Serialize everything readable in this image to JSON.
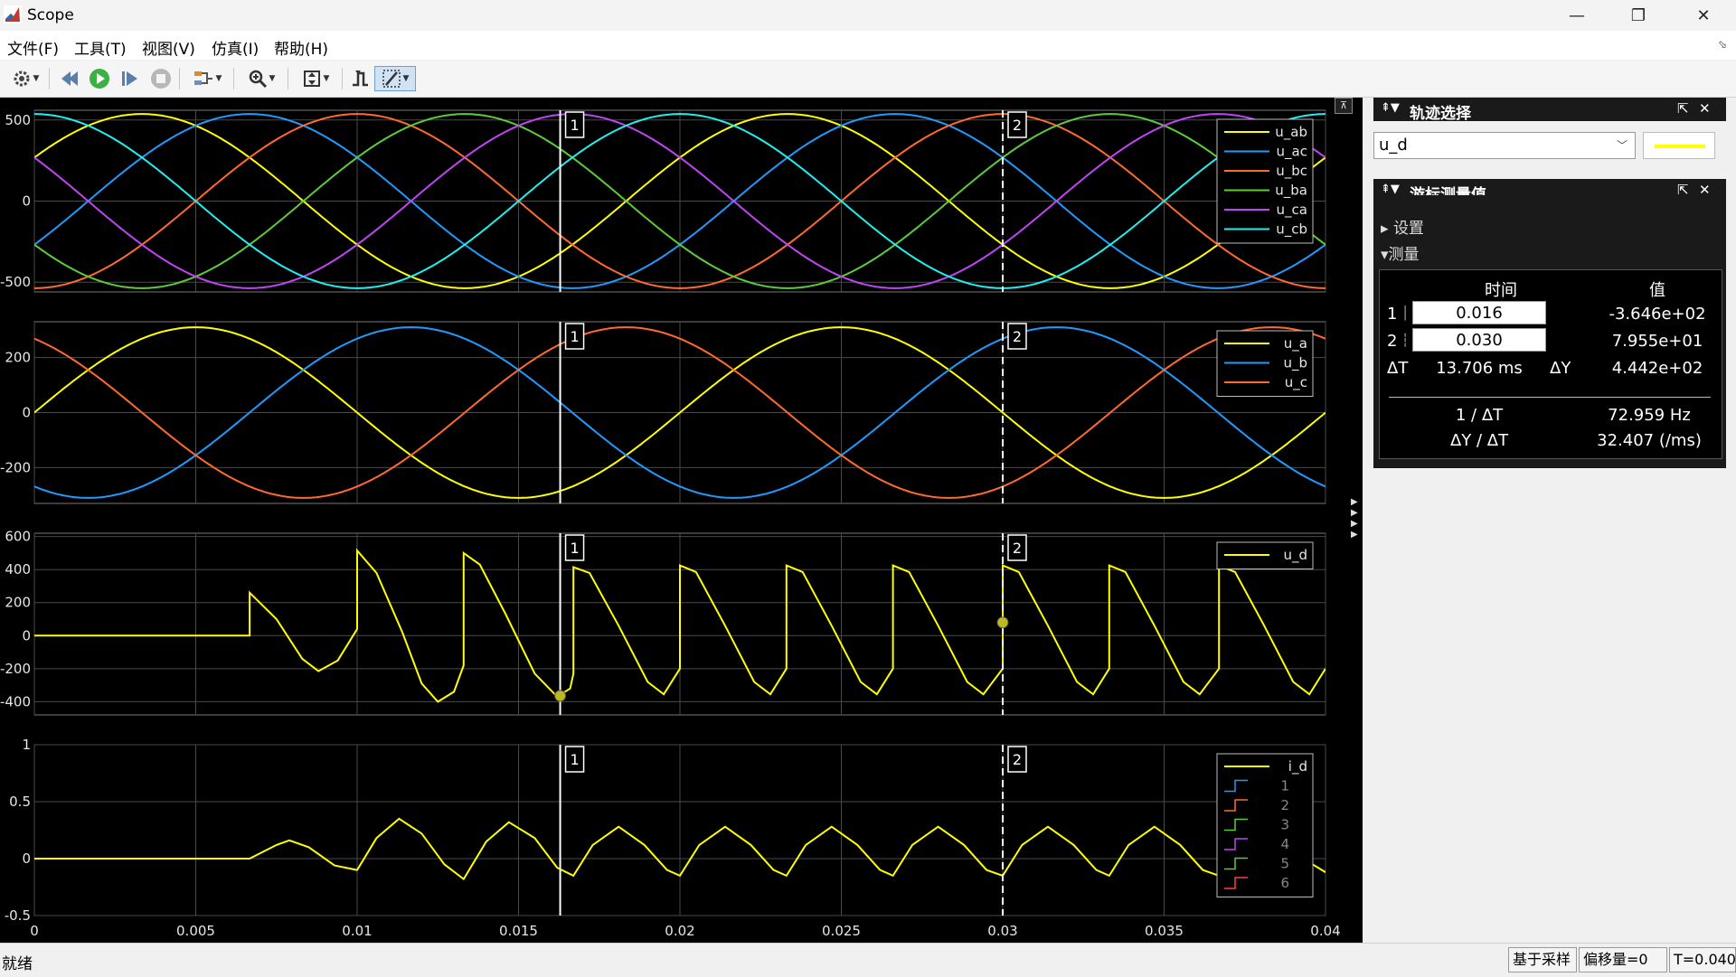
{
  "window": {
    "title": "Scope",
    "minimize": "—",
    "maximize": "❐",
    "close": "✕"
  },
  "menu": [
    "文件(F)",
    "工具(T)",
    "视图(V)",
    "仿真(I)",
    "帮助(H)"
  ],
  "toolbar_icons": [
    "settings-icon",
    "step-back-icon",
    "run-icon",
    "step-forward-icon",
    "stop-icon",
    "signal-select-icon",
    "zoom-icon",
    "axes-scale-icon",
    "trigger-icon",
    "cursor-measure-icon"
  ],
  "colors": {
    "background": "#000000",
    "grid": "#4a4a4a",
    "axes_text": "#e6e6e6",
    "yellow": "#ffff00",
    "blue": "#1f9bff",
    "orange": "#ff6a2f",
    "green": "#5ecc3a",
    "magenta": "#c045f5",
    "cyan": "#20f0f0"
  },
  "time_axis": {
    "min": 0,
    "max": 0.04,
    "ticks": [
      "0",
      "0.005",
      "0.01",
      "0.015",
      "0.02",
      "0.025",
      "0.03",
      "0.035",
      "0.04"
    ]
  },
  "cursors": [
    {
      "label": "1",
      "t": 0.01629,
      "style": "solid"
    },
    {
      "label": "2",
      "t": 0.03,
      "style": "dashed"
    }
  ],
  "chart_data": [
    {
      "type": "line",
      "ylim": [
        -560,
        560
      ],
      "yticks": [
        "500",
        "0",
        "-500"
      ],
      "ytick_values": [
        500,
        0,
        -500
      ],
      "series": [
        {
          "name": "u_ab",
          "color": "#ffff00",
          "amplitude": 537,
          "freq_hz": 50,
          "phase_deg": 30
        },
        {
          "name": "u_ac",
          "color": "#1f9bff",
          "amplitude": 537,
          "freq_hz": 50,
          "phase_deg": -30
        },
        {
          "name": "u_bc",
          "color": "#ff6a2f",
          "amplitude": 537,
          "freq_hz": 50,
          "phase_deg": -90
        },
        {
          "name": "u_ba",
          "color": "#5ecc3a",
          "amplitude": 537,
          "freq_hz": 50,
          "phase_deg": -150
        },
        {
          "name": "u_ca",
          "color": "#c045f5",
          "amplitude": 537,
          "freq_hz": 50,
          "phase_deg": 150
        },
        {
          "name": "u_cb",
          "color": "#20f0f0",
          "amplitude": 537,
          "freq_hz": 50,
          "phase_deg": 90
        }
      ]
    },
    {
      "type": "line",
      "ylim": [
        -330,
        330
      ],
      "yticks": [
        "200",
        "0",
        "-200"
      ],
      "ytick_values": [
        200,
        0,
        -200
      ],
      "series": [
        {
          "name": "u_a",
          "color": "#ffff00",
          "amplitude": 310,
          "freq_hz": 50,
          "phase_deg": 0
        },
        {
          "name": "u_b",
          "color": "#1f9bff",
          "amplitude": 310,
          "freq_hz": 50,
          "phase_deg": -120
        },
        {
          "name": "u_c",
          "color": "#ff6a2f",
          "amplitude": 310,
          "freq_hz": 50,
          "phase_deg": 120
        }
      ]
    },
    {
      "type": "line",
      "ylim": [
        -480,
        620
      ],
      "yticks": [
        "600",
        "400",
        "200",
        "0",
        "-200",
        "-400"
      ],
      "ytick_values": [
        600,
        400,
        200,
        0,
        -200,
        -400
      ],
      "series": [
        {
          "name": "u_d",
          "color": "#ffff00",
          "points": [
            [
              0,
              0
            ],
            [
              0.00667,
              0
            ],
            [
              0.00667,
              260
            ],
            [
              0.0075,
              100
            ],
            [
              0.0083,
              -140
            ],
            [
              0.0088,
              -215
            ],
            [
              0.0094,
              -150
            ],
            [
              0.01,
              40
            ],
            [
              0.01,
              515
            ],
            [
              0.0106,
              380
            ],
            [
              0.0114,
              20
            ],
            [
              0.012,
              -290
            ],
            [
              0.0125,
              -400
            ],
            [
              0.013,
              -340
            ],
            [
              0.0133,
              -180
            ],
            [
              0.0133,
              500
            ],
            [
              0.0138,
              430
            ],
            [
              0.0146,
              130
            ],
            [
              0.0155,
              -230
            ],
            [
              0.0162,
              -370
            ],
            [
              0.0166,
              -320
            ],
            [
              0.0167,
              -230
            ],
            [
              0.0167,
              415
            ],
            [
              0.0172,
              380
            ],
            [
              0.0181,
              60
            ],
            [
              0.019,
              -280
            ],
            [
              0.0195,
              -355
            ],
            [
              0.02,
              -200
            ],
            [
              0.02,
              425
            ],
            [
              0.0205,
              385
            ],
            [
              0.0214,
              60
            ],
            [
              0.0223,
              -280
            ],
            [
              0.0228,
              -355
            ],
            [
              0.0233,
              -200
            ],
            [
              0.0233,
              425
            ],
            [
              0.0238,
              385
            ],
            [
              0.0247,
              60
            ],
            [
              0.0256,
              -280
            ],
            [
              0.0261,
              -355
            ],
            [
              0.0266,
              -200
            ],
            [
              0.0266,
              425
            ],
            [
              0.0271,
              385
            ],
            [
              0.028,
              60
            ],
            [
              0.0289,
              -280
            ],
            [
              0.0294,
              -355
            ],
            [
              0.03,
              -200
            ],
            [
              0.03,
              425
            ],
            [
              0.0305,
              385
            ],
            [
              0.0314,
              60
            ],
            [
              0.0323,
              -280
            ],
            [
              0.0328,
              -355
            ],
            [
              0.0333,
              -200
            ],
            [
              0.0333,
              425
            ],
            [
              0.0338,
              385
            ],
            [
              0.0347,
              60
            ],
            [
              0.0356,
              -280
            ],
            [
              0.0361,
              -355
            ],
            [
              0.0367,
              -200
            ],
            [
              0.0367,
              425
            ],
            [
              0.0372,
              385
            ],
            [
              0.0381,
              60
            ],
            [
              0.039,
              -280
            ],
            [
              0.0395,
              -355
            ],
            [
              0.04,
              -200
            ]
          ]
        }
      ]
    },
    {
      "type": "line",
      "ylim": [
        -0.5,
        1.0
      ],
      "yticks": [
        "1",
        "0.5",
        "0",
        "-0.5"
      ],
      "ytick_values": [
        1,
        0.5,
        0,
        -0.5
      ],
      "series": [
        {
          "name": "i_d",
          "color": "#ffff00",
          "points": [
            [
              0,
              0
            ],
            [
              0.00667,
              0
            ],
            [
              0.0075,
              0.12
            ],
            [
              0.0079,
              0.16
            ],
            [
              0.0085,
              0.1
            ],
            [
              0.0093,
              -0.06
            ],
            [
              0.01,
              -0.1
            ],
            [
              0.0106,
              0.18
            ],
            [
              0.0113,
              0.35
            ],
            [
              0.012,
              0.22
            ],
            [
              0.0127,
              -0.05
            ],
            [
              0.0133,
              -0.18
            ],
            [
              0.014,
              0.15
            ],
            [
              0.0147,
              0.32
            ],
            [
              0.0155,
              0.18
            ],
            [
              0.0162,
              -0.08
            ],
            [
              0.0167,
              -0.15
            ],
            [
              0.0173,
              0.12
            ],
            [
              0.0181,
              0.28
            ],
            [
              0.0189,
              0.12
            ],
            [
              0.0196,
              -0.1
            ],
            [
              0.02,
              -0.15
            ],
            [
              0.0206,
              0.12
            ],
            [
              0.0214,
              0.28
            ],
            [
              0.0222,
              0.12
            ],
            [
              0.0229,
              -0.1
            ],
            [
              0.0233,
              -0.15
            ],
            [
              0.0239,
              0.12
            ],
            [
              0.0247,
              0.28
            ],
            [
              0.0255,
              0.12
            ],
            [
              0.0262,
              -0.1
            ],
            [
              0.0266,
              -0.15
            ],
            [
              0.0272,
              0.12
            ],
            [
              0.028,
              0.28
            ],
            [
              0.0288,
              0.12
            ],
            [
              0.0295,
              -0.1
            ],
            [
              0.03,
              -0.15
            ],
            [
              0.0306,
              0.12
            ],
            [
              0.0314,
              0.28
            ],
            [
              0.0322,
              0.12
            ],
            [
              0.0329,
              -0.1
            ],
            [
              0.0333,
              -0.15
            ],
            [
              0.0339,
              0.12
            ],
            [
              0.0347,
              0.28
            ],
            [
              0.0355,
              0.12
            ],
            [
              0.0362,
              -0.1
            ],
            [
              0.0367,
              -0.15
            ],
            [
              0.0373,
              0.12
            ],
            [
              0.0381,
              0.28
            ],
            [
              0.0389,
              0.12
            ],
            [
              0.0396,
              -0.05
            ],
            [
              0.04,
              -0.12
            ]
          ]
        }
      ],
      "legend_extra": [
        {
          "name": "1",
          "color": "#1f9bff"
        },
        {
          "name": "2",
          "color": "#ff6a2f"
        },
        {
          "name": "3",
          "color": "#5ecc3a"
        },
        {
          "name": "4",
          "color": "#c045f5"
        },
        {
          "name": "5",
          "color": "#5ecc3a"
        },
        {
          "name": "6",
          "color": "#ff4040"
        }
      ]
    }
  ],
  "trace_panel": {
    "title": "轨迹选择",
    "selected": "u_d",
    "swatch_color": "#ffff00"
  },
  "cursor_panel": {
    "title": "游标测量值",
    "settings_label": "设置",
    "measure_label": "测量",
    "col_time": "时间",
    "col_value": "值",
    "row1": {
      "id": "1",
      "time": "0.016",
      "value": "-3.646e+02"
    },
    "row2": {
      "id": "2",
      "time": "0.030",
      "value": "7.955e+01"
    },
    "dt_label": "ΔT",
    "dt_value": "13.706 ms",
    "dy_label": "ΔY",
    "dy_value": "4.442e+02",
    "inv_dt_label": "1 / ΔT",
    "inv_dt_value": "72.959 Hz",
    "slope_label": "ΔY / ΔT",
    "slope_value": "32.407 (/ms)"
  },
  "status": {
    "text": "就绪",
    "mode": "基于采样",
    "offset": "偏移量=0",
    "time": "T=0.040"
  }
}
